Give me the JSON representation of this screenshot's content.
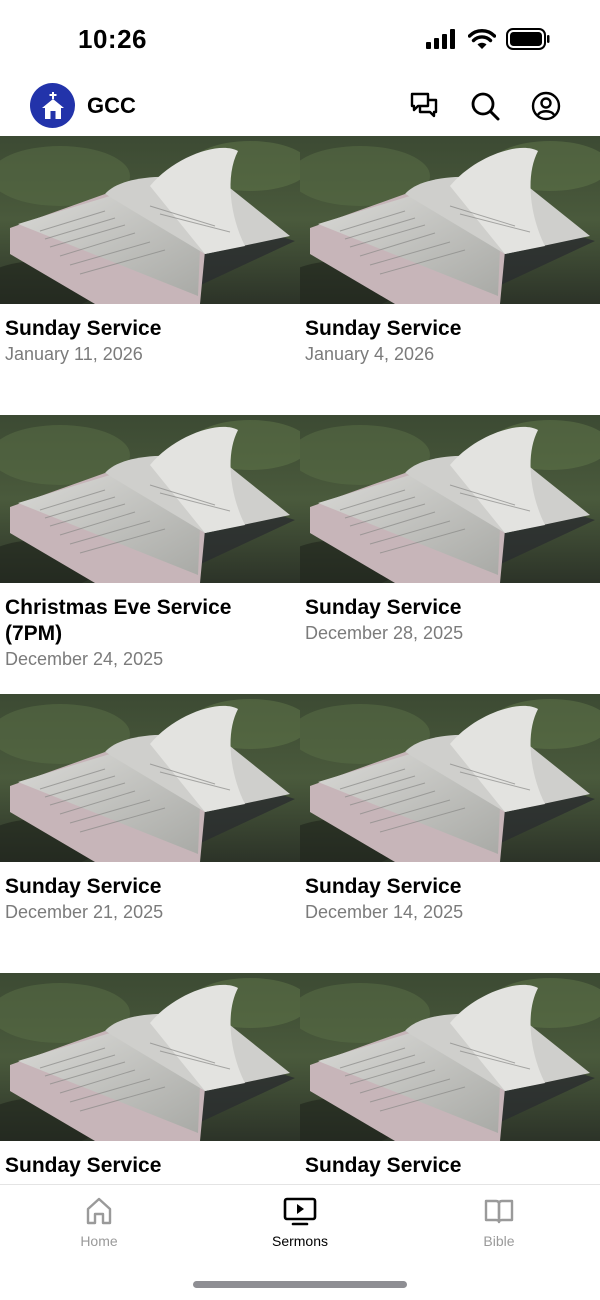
{
  "status_bar": {
    "time": "10:26"
  },
  "header": {
    "app_name": "GCC"
  },
  "sermons": [
    {
      "title": "Sunday Service",
      "date": "January 11, 2026"
    },
    {
      "title": "Sunday Service",
      "date": "January 4, 2026"
    },
    {
      "title": "Christmas Eve Service (7PM)",
      "date": "December 24, 2025"
    },
    {
      "title": "Sunday Service",
      "date": "December 28, 2025"
    },
    {
      "title": "Sunday Service",
      "date": "December 21, 2025"
    },
    {
      "title": "Sunday Service",
      "date": "December 14, 2025"
    },
    {
      "title": "Sunday Service",
      "date": ""
    },
    {
      "title": "Sunday Service",
      "date": ""
    }
  ],
  "tabs": [
    {
      "label": "Home",
      "icon": "home-icon",
      "active": false
    },
    {
      "label": "Sermons",
      "icon": "tv-play-icon",
      "active": true
    },
    {
      "label": "Bible",
      "icon": "book-icon",
      "active": false
    }
  ],
  "colors": {
    "brand": "#2233aa",
    "inactive_tab": "#9a9a9a",
    "date_text": "#7b7b7b"
  }
}
